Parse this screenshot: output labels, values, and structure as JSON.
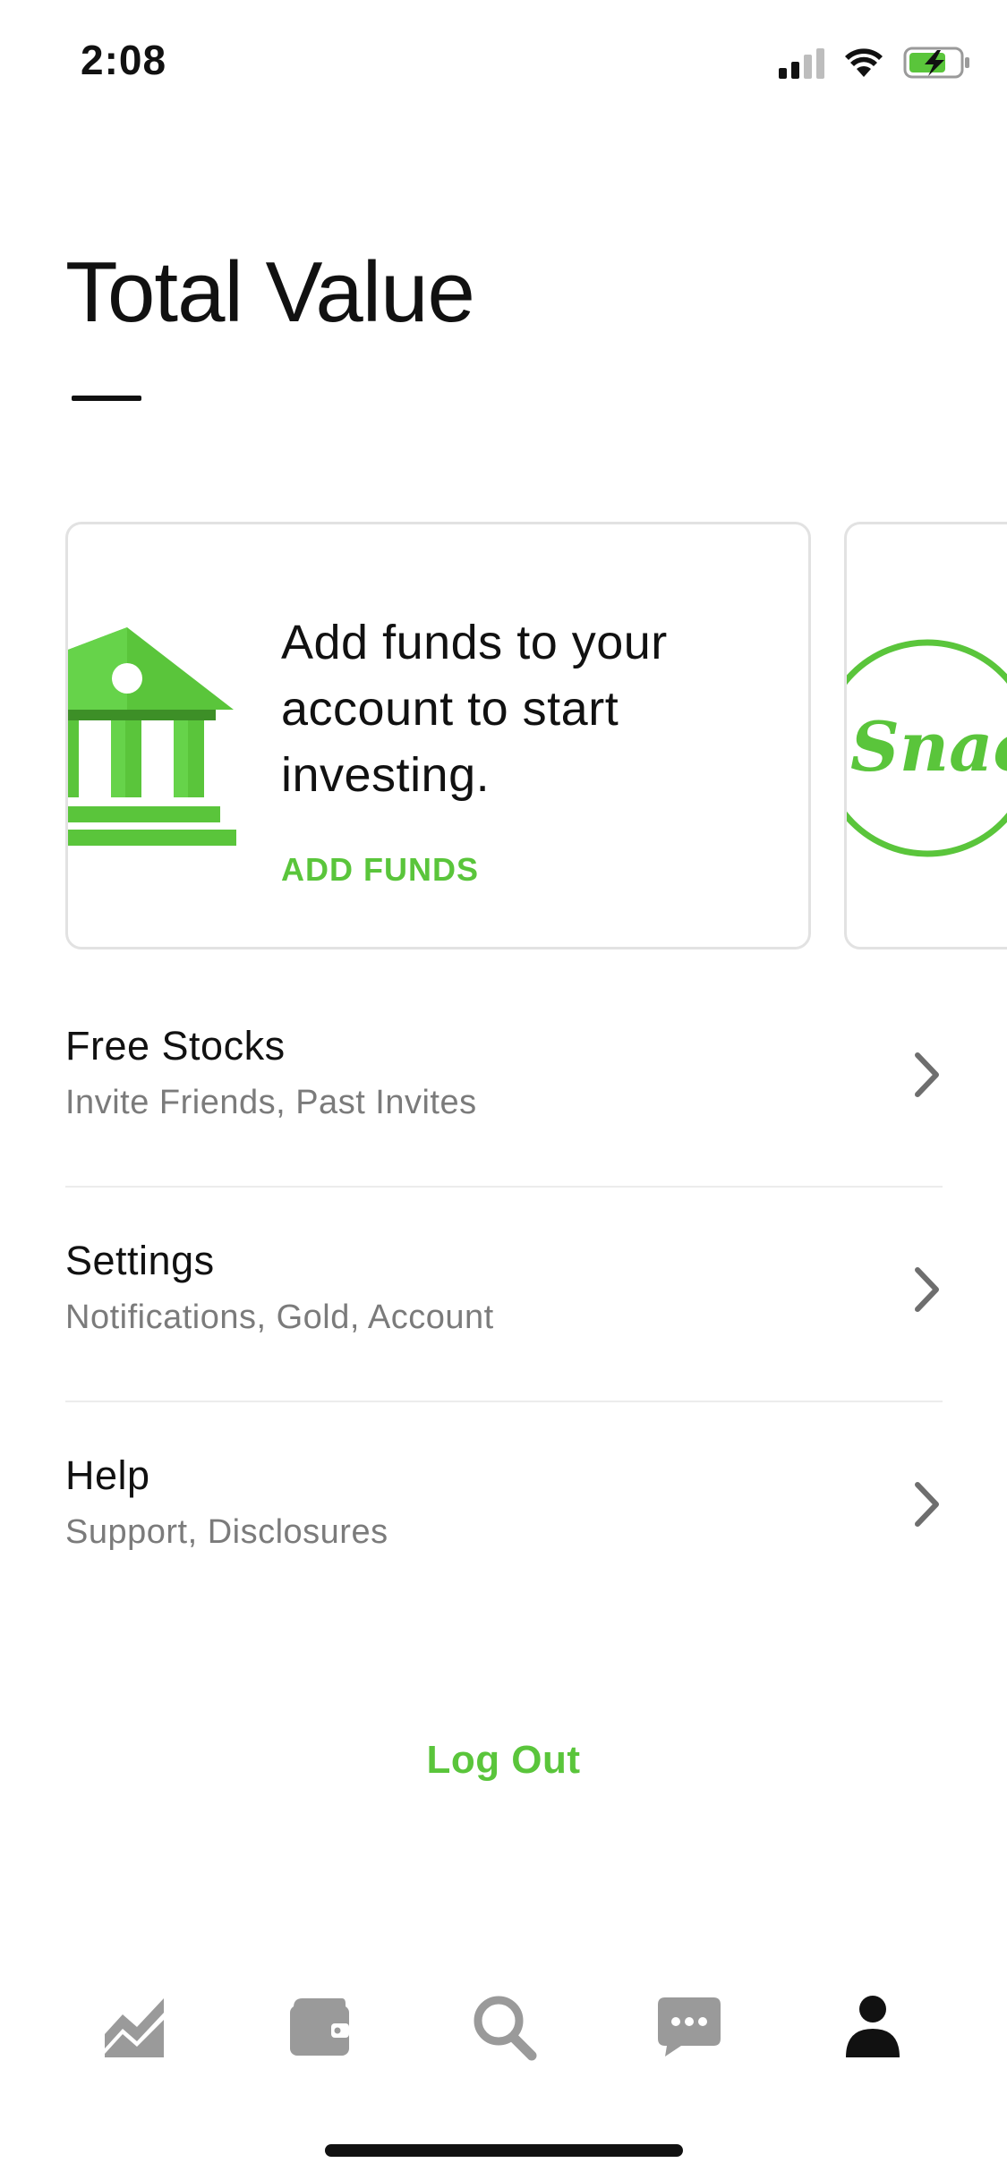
{
  "status_bar": {
    "time": "2:08",
    "icons": [
      "cellular-signal-icon",
      "wifi-icon",
      "battery-charging-icon"
    ]
  },
  "header": {
    "title": "Total Value",
    "value": "—"
  },
  "cards": [
    {
      "icon": "bank-building-icon",
      "text": "Add funds to your account to start investing.",
      "cta": "ADD FUNDS"
    },
    {
      "icon": "snacks-logo",
      "logo_text": "Snacks"
    }
  ],
  "menu": {
    "items": [
      {
        "title": "Free Stocks",
        "subtitle": "Invite Friends, Past Invites",
        "icon": "chevron-right-icon"
      },
      {
        "title": "Settings",
        "subtitle": "Notifications, Gold, Account",
        "icon": "chevron-right-icon"
      },
      {
        "title": "Help",
        "subtitle": "Support, Disclosures",
        "icon": "chevron-right-icon"
      }
    ]
  },
  "logout_label": "Log Out",
  "tab_bar": {
    "tabs": [
      {
        "icon": "portfolio-chart-icon",
        "active": false
      },
      {
        "icon": "wallet-icon",
        "active": false
      },
      {
        "icon": "search-icon",
        "active": false
      },
      {
        "icon": "messages-icon",
        "active": false
      },
      {
        "icon": "account-icon",
        "active": true
      }
    ]
  },
  "colors": {
    "accent": "#5ac53b",
    "text_primary": "#111111",
    "text_secondary": "#7b7b7b",
    "tab_inactive": "#9a9a9a",
    "divider": "#ececec"
  }
}
